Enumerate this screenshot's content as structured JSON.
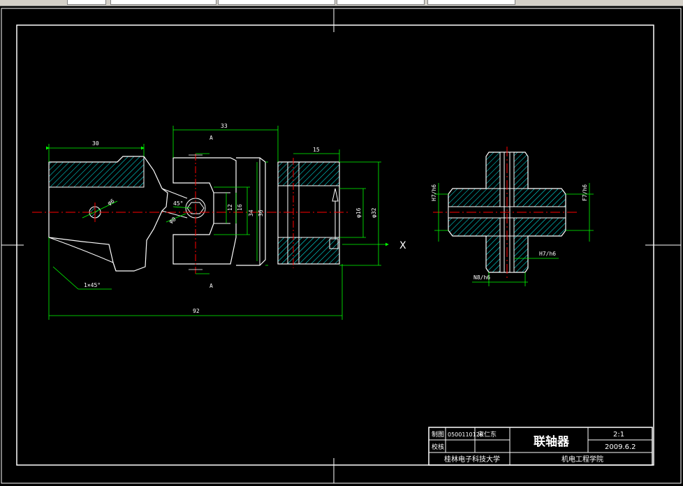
{
  "drawing": {
    "dimensions": {
      "left_width": "30",
      "middle_width": "33",
      "right_width": "15",
      "overall_length": "92",
      "chamfer": "1×45°",
      "section_mark": "A",
      "phi_small": "φ6",
      "angle": "45°",
      "phi_pin": "φ8",
      "d12": "12",
      "d16": "16",
      "d34": "34",
      "d36": "36",
      "phi16": "φ16",
      "phi32": "φ32",
      "axis_x": "X"
    },
    "cross_view": {
      "fit_left": "H7/h6",
      "fit_right": "F7/h6",
      "fit_bottom_right": "H7/h6",
      "fit_bottom": "N8/h6"
    },
    "title_block": {
      "drawn_label": "制图",
      "checked_label": "校核",
      "student_id": "0500110120",
      "author": "宋仁东",
      "part_name": "联轴器",
      "scale": "2:1",
      "date": "2009.6.2",
      "university": "桂林电子科技大学",
      "college": "机电工程学院"
    }
  },
  "colors": {
    "outline": "#ffffff",
    "dimension": "#00ff00",
    "centerline": "#ff0000",
    "hatch": "#00ffff",
    "background": "#000000"
  }
}
